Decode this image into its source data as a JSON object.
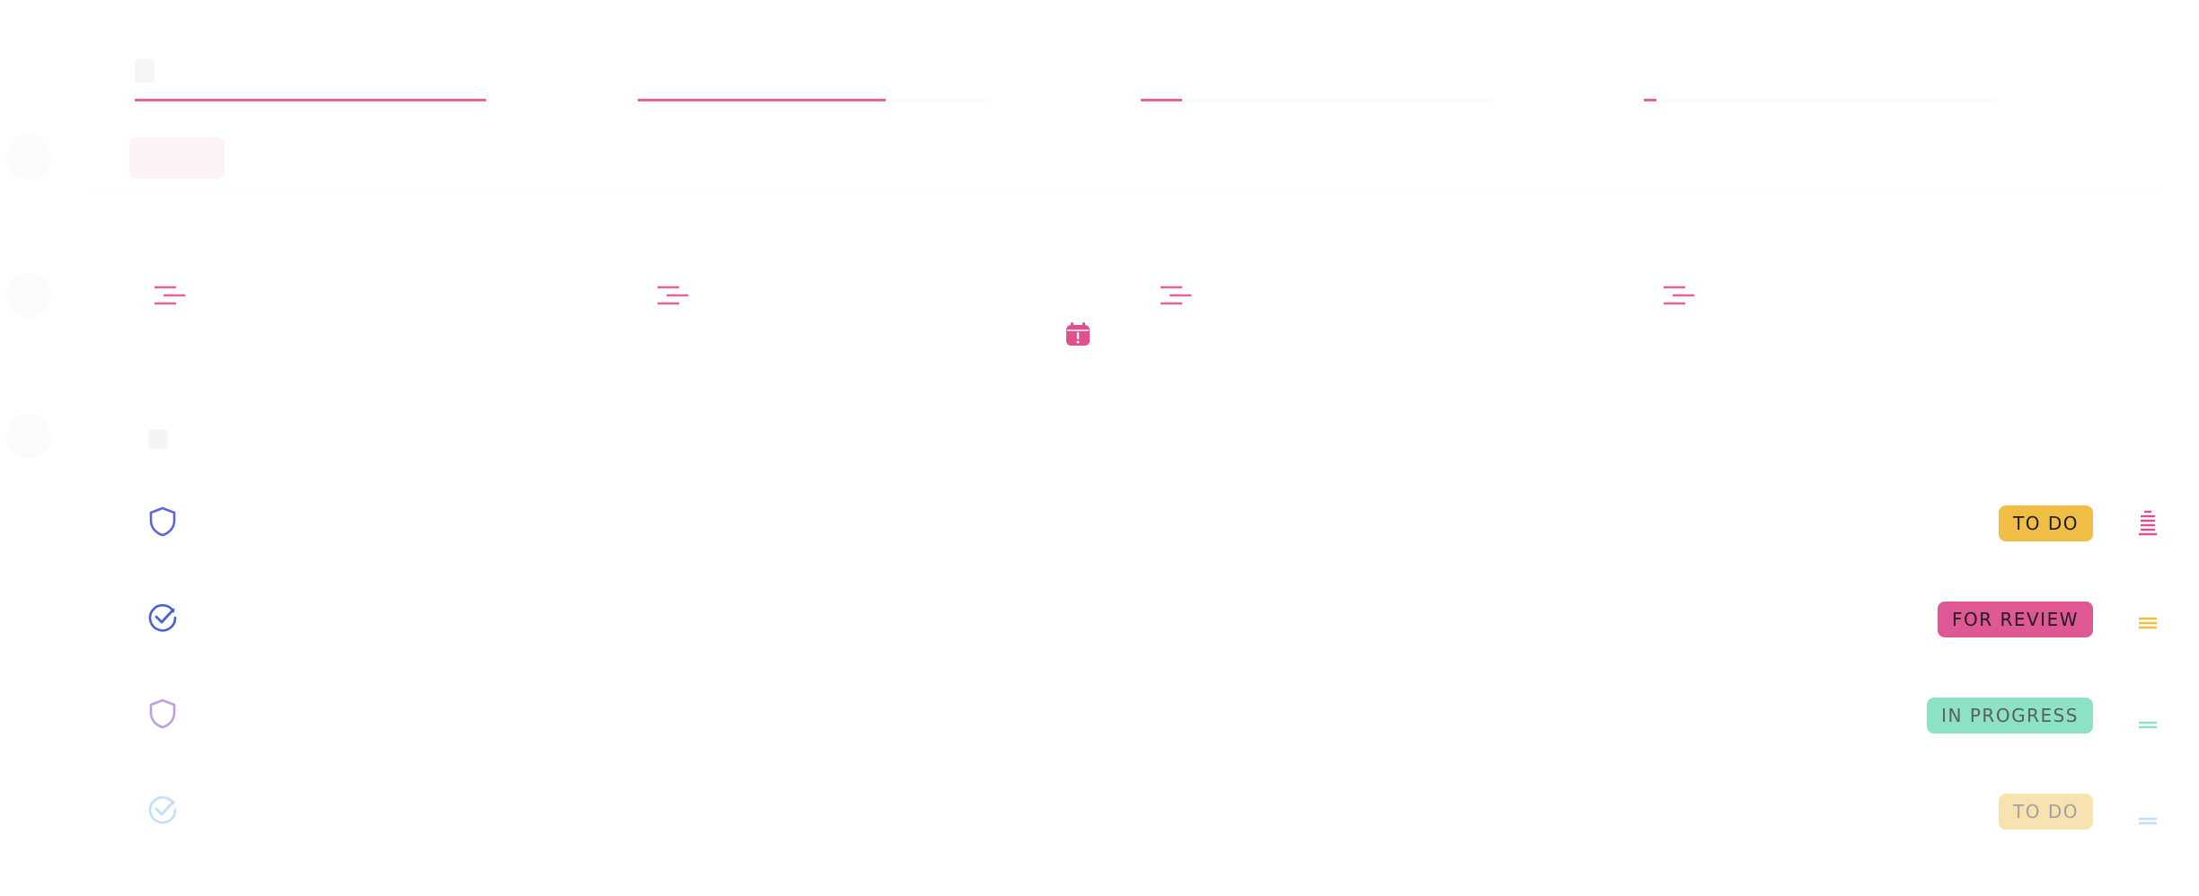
{
  "header": {
    "title": "",
    "status_chip": ""
  },
  "stats": [
    {
      "label": "",
      "value": "",
      "progress": 0.85
    },
    {
      "label": "",
      "value": "",
      "progress": 0.6
    },
    {
      "label": "",
      "value": "",
      "progress": 0.1
    },
    {
      "label": "",
      "value": "",
      "progress": 0.03
    }
  ],
  "section": {
    "title": ""
  },
  "tasks": [
    {
      "title": "",
      "date": "",
      "status": "TO DO",
      "status_color": "#f0bd45",
      "icon": "shield-icon",
      "icon_color": "#5e66d9",
      "priority_icon": "urgent-priority-icon",
      "priority_color": "#e0508f",
      "opacity": 1
    },
    {
      "title": "",
      "date": "",
      "status": "FOR REVIEW",
      "status_color": "#df5795",
      "icon": "check-circle-icon",
      "icon_color": "#4b5fd6",
      "priority_icon": "high-priority-icon",
      "priority_color": "#f0bd45",
      "opacity": 1
    },
    {
      "title": "",
      "date": "",
      "status": "IN PROGRESS",
      "status_color": "#5fd8b2",
      "icon": "shield-icon",
      "icon_color": "#a07ed8",
      "priority_icon": "normal-priority-icon",
      "priority_color": "#5fd8b2",
      "opacity": 0.72
    },
    {
      "title": "",
      "date": "",
      "status": "TO DO",
      "status_color": "#f0bd45",
      "icon": "check-circle-icon",
      "icon_color": "#6fb3f0",
      "priority_icon": "low-priority-icon",
      "priority_color": "#6fb3f0",
      "opacity": 0.42
    }
  ],
  "colors": {
    "accent": "#e8639a"
  }
}
